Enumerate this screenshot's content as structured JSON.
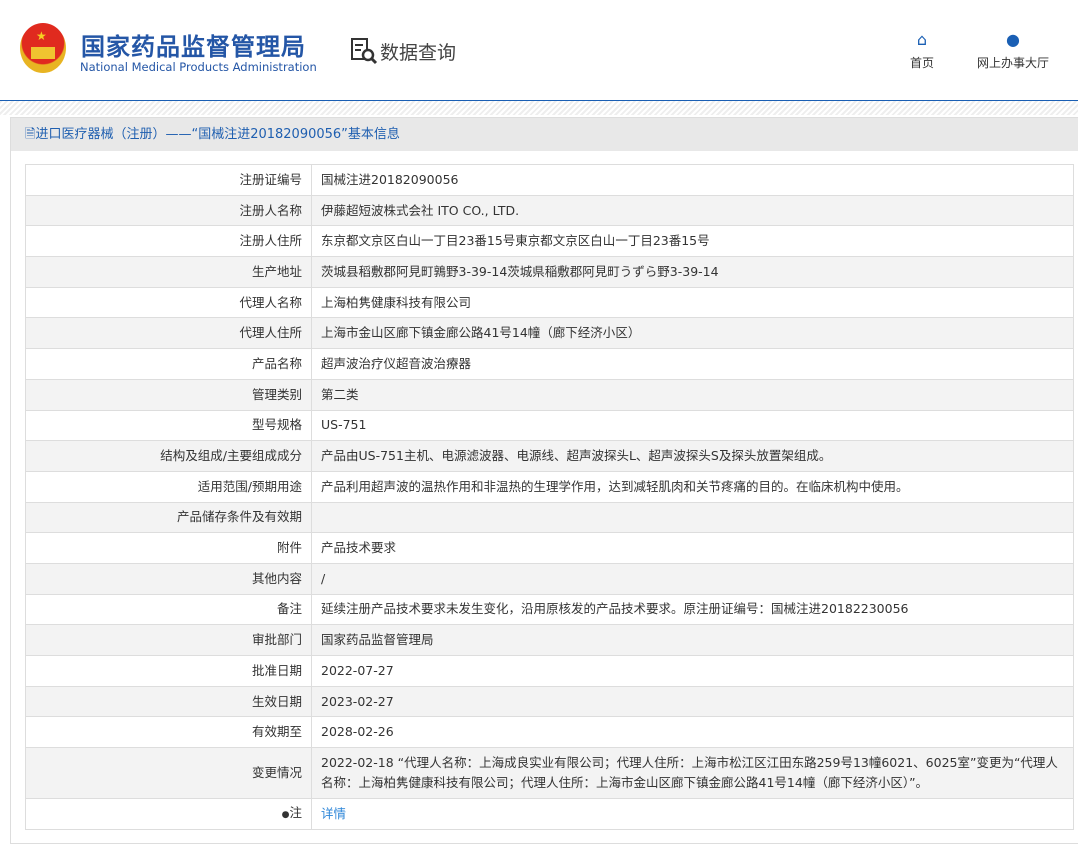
{
  "header": {
    "title_cn": "国家药品监督管理局",
    "title_en": "National Medical Products Administration",
    "query_label": "数据查询",
    "nav": [
      {
        "label": "首页",
        "icon": "home-icon"
      },
      {
        "label": "网上办事大厅",
        "icon": "user-icon"
      }
    ]
  },
  "bar_title": "进口医疗器械（注册）——“国械注进20182090056”基本信息",
  "rows": [
    {
      "label": "注册证编号",
      "value": "国械注进20182090056"
    },
    {
      "label": "注册人名称",
      "value": "伊藤超短波株式会社 ITO CO., LTD."
    },
    {
      "label": "注册人住所",
      "value": "东京都文京区白山一丁目23番15号東京都文京区白山一丁目23番15号"
    },
    {
      "label": "生产地址",
      "value": "茨城县稻敷郡阿見町鶉野3-39-14茨城県稲敷郡阿見町うずら野3-39-14"
    },
    {
      "label": "代理人名称",
      "value": "上海柏隽健康科技有限公司"
    },
    {
      "label": "代理人住所",
      "value": "上海市金山区廊下镇金廊公路41号14幢（廊下经济小区）"
    },
    {
      "label": "产品名称",
      "value": "超声波治疗仪超音波治療器"
    },
    {
      "label": "管理类别",
      "value": "第二类"
    },
    {
      "label": "型号规格",
      "value": "US-751"
    },
    {
      "label": "结构及组成/主要组成成分",
      "value": "产品由US-751主机、电源滤波器、电源线、超声波探头L、超声波探头S及探头放置架组成。"
    },
    {
      "label": "适用范围/预期用途",
      "value": "产品利用超声波的温热作用和非温热的生理学作用，达到减轻肌肉和关节疼痛的目的。在临床机构中使用。"
    },
    {
      "label": "产品储存条件及有效期",
      "value": ""
    },
    {
      "label": "附件",
      "value": "产品技术要求"
    },
    {
      "label": "其他内容",
      "value": "/"
    },
    {
      "label": "备注",
      "value": "延续注册产品技术要求未发生变化，沿用原核发的产品技术要求。原注册证编号：国械注进20182230056"
    },
    {
      "label": "审批部门",
      "value": "国家药品监督管理局"
    },
    {
      "label": "批准日期",
      "value": "2022-07-27"
    },
    {
      "label": "生效日期",
      "value": "2023-02-27"
    },
    {
      "label": "有效期至",
      "value": "2028-02-26"
    },
    {
      "label": "变更情况",
      "value": "2022-02-18 “代理人名称：上海成良实业有限公司；代理人住所：上海市松江区江田东路259号13幢6021、6025室”变更为“代理人名称：上海柏隽健康科技有限公司；代理人住所：上海市金山区廊下镇金廊公路41号14幢（廊下经济小区）”。"
    },
    {
      "label": "注",
      "value": "详情"
    }
  ]
}
